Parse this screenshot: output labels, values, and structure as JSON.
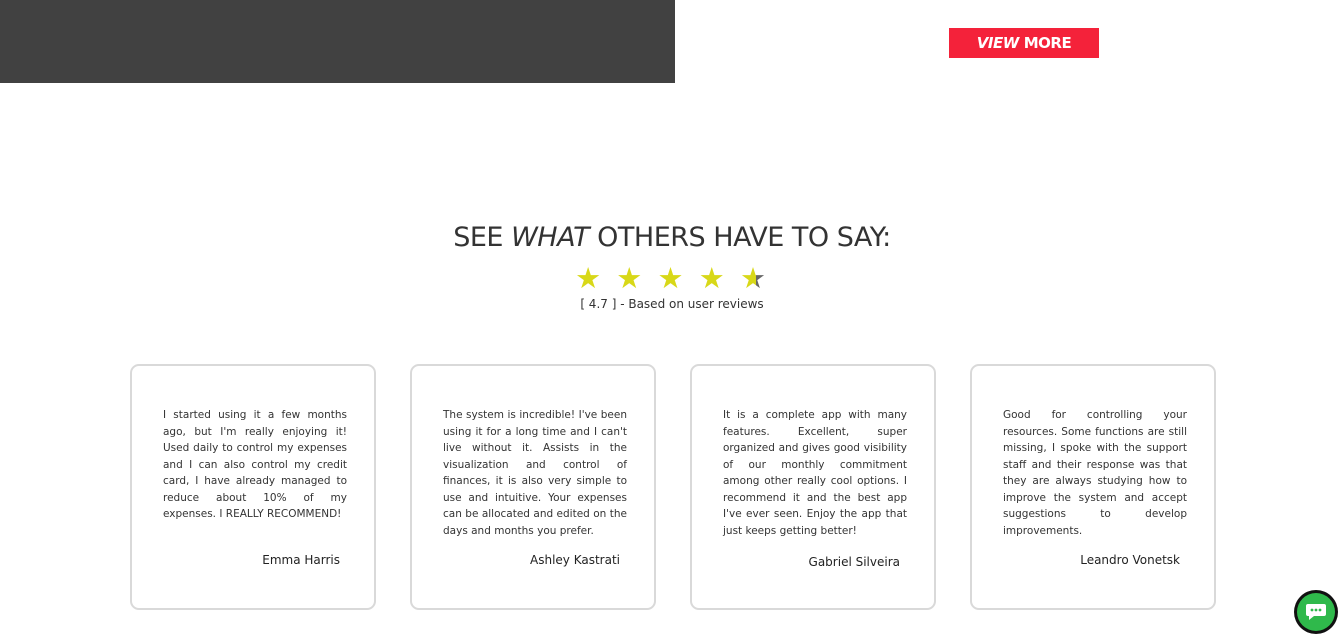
{
  "header": {
    "view_more_part1": "VIEW",
    "view_more_part2": "MORE"
  },
  "reviews_section": {
    "title_part1": "SEE",
    "title_part2": "WHAT",
    "title_part3": "OTHERS HAVE TO SAY:",
    "rating_value": 4.7,
    "rating_max": 5,
    "rating_line": "[ 4.7 ] - Based on user reviews",
    "star_icon": "star-icon",
    "star_color": "#d8d818"
  },
  "reviews": [
    {
      "text": "I started using it a few months ago, but I'm really enjoying it! Used daily to control my expenses and I can also control my credit card, I have already managed to reduce about 10% of my expenses. I REALLY RECOMMEND!",
      "author": "Emma Harris"
    },
    {
      "text": "The system is incredible! I've been using it for a long time and I can't live without it. Assists in the visualization and control of finances, it is also very simple to use and intuitive. Your expenses can be allocated and edited on the days and months you prefer.",
      "author": "Ashley Kastrati"
    },
    {
      "text": "It is a complete app with many features. Excellent, super organized and gives good visibility of our monthly commitment among other really cool options. I recommend it and the best app I've ever seen. Enjoy the app that just keeps getting better!",
      "author": "Gabriel Silveira"
    },
    {
      "text": "Good for controlling your resources. Some functions are still missing, I spoke with the support staff and their response was that they are always studying how to improve the system and accept suggestions to develop improvements.",
      "author": "Leandro Vonetsk"
    }
  ],
  "chat_widget": {
    "icon": "chat-bubble-icon",
    "color": "#2fb94b"
  },
  "colors": {
    "accent": "#f4223a",
    "dark_panel": "#414141"
  }
}
